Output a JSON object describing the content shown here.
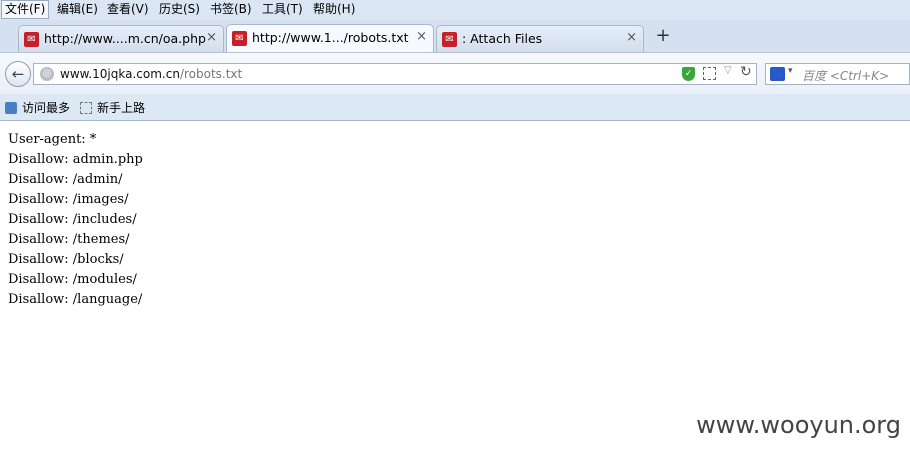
{
  "menu": [
    {
      "label": "文件(F)"
    },
    {
      "label": "编辑(E)"
    },
    {
      "label": "查看(V)"
    },
    {
      "label": "历史(S)"
    },
    {
      "label": "书签(B)"
    },
    {
      "label": "工具(T)"
    },
    {
      "label": "帮助(H)"
    }
  ],
  "tabs": [
    {
      "title": "http://www....m.cn/oa.php",
      "close": "×",
      "selected": false
    },
    {
      "title": "http://www.1.../robots.txt",
      "close": "×",
      "selected": true
    },
    {
      "title": ": Attach Files",
      "close": "×",
      "selected": false
    }
  ],
  "new_tab": "+",
  "nav": {
    "back_icon": "back-arrow-icon",
    "url_host": "www.10jqka.com.cn",
    "url_path": "/robots.txt",
    "security_icon": "shield-icon",
    "qr_icon": "qr-code-icon",
    "dropdown_icon": "▽",
    "reload_icon": "↻"
  },
  "search": {
    "engine_icon": "baidu-paw-icon",
    "dropdown": "▾",
    "placeholder": "百度 <Ctrl+K>"
  },
  "bookmarks": [
    {
      "label": "访问最多",
      "icon": "most-visited-icon"
    },
    {
      "label": "新手上路",
      "icon": "page-icon"
    }
  ],
  "content": {
    "lines": [
      "User-agent: *",
      "Disallow: admin.php",
      "Disallow: /admin/",
      "Disallow: /images/",
      "Disallow: /includes/",
      "Disallow: /themes/",
      "Disallow: /blocks/",
      "Disallow: /modules/",
      "Disallow: /language/"
    ]
  },
  "watermark": "www.wooyun.org"
}
